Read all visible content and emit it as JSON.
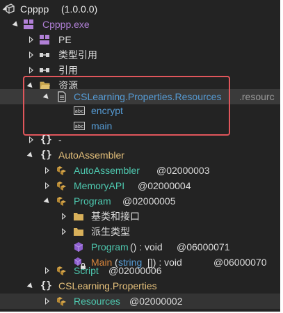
{
  "tree": {
    "assembly": {
      "label": "Cpppp",
      "version": "(1.0.0.0)"
    },
    "module": {
      "label": "Cpppp.exe"
    },
    "module_children": {
      "pe": "PE",
      "type_refs": "类型引用",
      "refs": "引用",
      "resources": "资源"
    },
    "resource_file": {
      "name": "CSLearning.Properties.Resources",
      "ext": ".resourc"
    },
    "resource_items": [
      "encrypt",
      "main"
    ],
    "empty_ns": "-",
    "ns_autoassembler": "AutoAssembler",
    "types": {
      "autoassembler": {
        "name": "AutoAssembler",
        "token": "@02000003"
      },
      "memoryapi": {
        "name": "MemoryAPI",
        "token": "@02000004"
      },
      "program": {
        "name": "Program",
        "token": "@02000005"
      }
    },
    "program_children": {
      "base_interfaces": "基类和接口",
      "derived_types": "派生类型"
    },
    "methods": {
      "ctor": {
        "name": "Program",
        "sig": "() : void",
        "token": "@06000071"
      },
      "main": {
        "name": "Main",
        "paren_open": "(",
        "param": "string",
        "sig_tail": "[]) : void",
        "token": "@06000070"
      }
    },
    "script": {
      "name": "Script",
      "token": "@02000006"
    },
    "ns_properties": "CSLearning.Properties",
    "resources_type": {
      "name": "Resources",
      "token": "@02000002"
    }
  },
  "colors": {
    "class": "#4ec9b0",
    "namespace": "#e5c07b",
    "resource": "#569cd6",
    "method_ctor": "#4ec9b0",
    "method_main": "#d7843b",
    "keyword": "#569cd6",
    "highlight_border": "#e0565b"
  }
}
